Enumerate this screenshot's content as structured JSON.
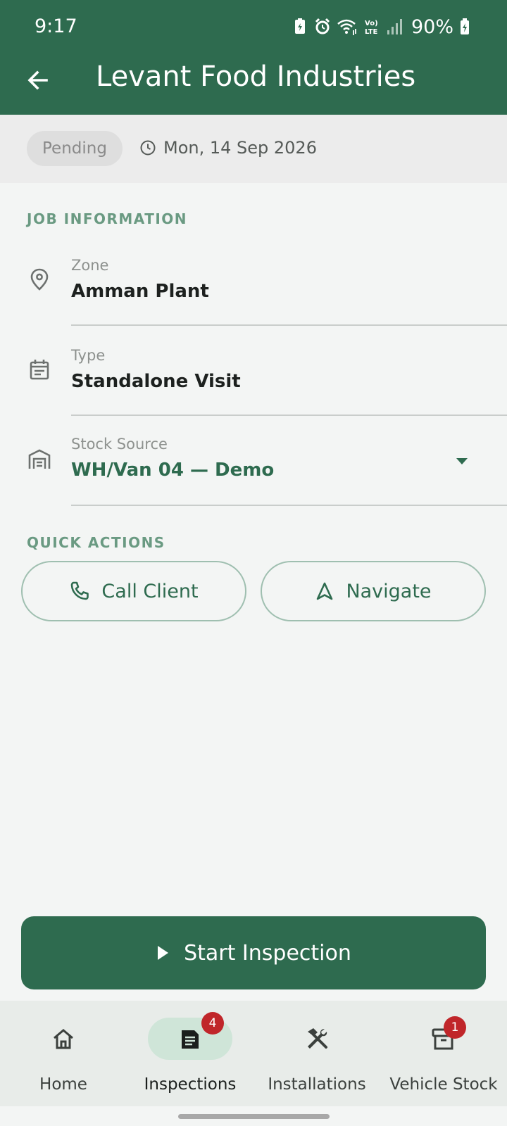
{
  "status_bar": {
    "time": "9:17",
    "battery": "90%",
    "icons": [
      "battery-saver-icon",
      "alarm-icon",
      "wifi-icon",
      "volte-icon",
      "signal-icon",
      "battery-icon"
    ]
  },
  "app_bar": {
    "title": "Levant Food Industries",
    "back_icon": "arrow-left-icon"
  },
  "job_status": {
    "badge": "Pending",
    "date": "Mon, 14 Sep 2026"
  },
  "job_information": {
    "heading": "JOB INFORMATION",
    "rows": [
      {
        "icon": "location-pin-icon",
        "label": "Zone",
        "value": "Amman Plant"
      },
      {
        "icon": "calendar-icon",
        "label": "Type",
        "value": "Standalone Visit"
      },
      {
        "icon": "warehouse-icon",
        "label": "Stock Source",
        "value": "WH/Van 04 — Demo"
      }
    ]
  },
  "quick_actions": {
    "heading": "QUICK ACTIONS",
    "call_label": "Call Client",
    "navigate_label": "Navigate"
  },
  "primary_action": {
    "label": "Start Inspection"
  },
  "bottom_nav": {
    "items": [
      {
        "label": "Home",
        "icon": "home-icon",
        "badge": ""
      },
      {
        "label": "Inspections",
        "icon": "clipboard-icon",
        "badge": "4"
      },
      {
        "label": "Installations",
        "icon": "tools-icon",
        "badge": ""
      },
      {
        "label": "Vehicle Stock",
        "icon": "archive-box-icon",
        "badge": "1"
      }
    ],
    "active_index": 1
  },
  "colors": {
    "brand": "#2e6b4f",
    "badge": "#c0262a",
    "section_label": "#6a9a82"
  }
}
